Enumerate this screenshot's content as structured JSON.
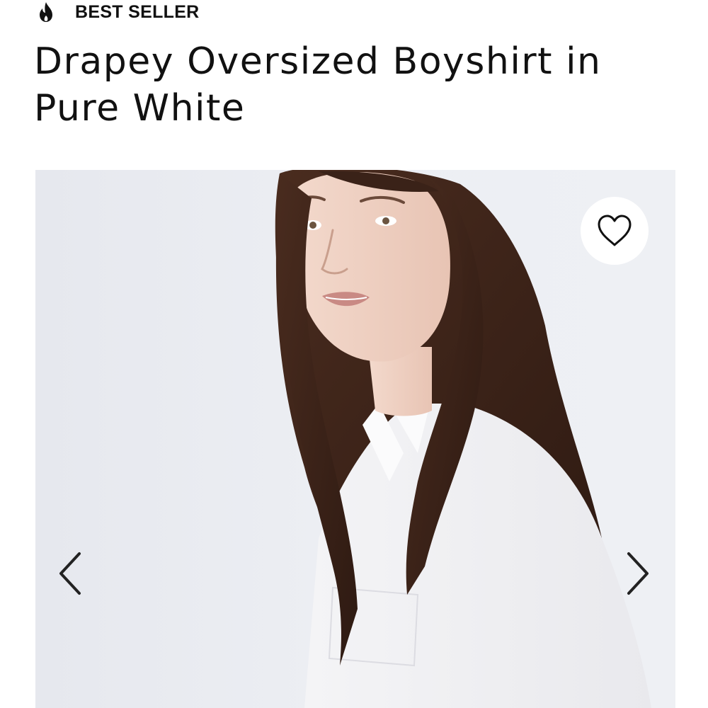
{
  "badge": {
    "icon": "flame-icon",
    "label": "BEST SELLER"
  },
  "product": {
    "title": "Drapey Oversized Boyshirt in Pure White"
  },
  "gallery": {
    "image_subject": "model wearing white oversized button-up shirt",
    "favorite_icon": "heart-outline-icon",
    "prev_icon": "chevron-left-icon",
    "next_icon": "chevron-right-icon"
  },
  "colors": {
    "text": "#111111",
    "gallery_background": "#eceef3",
    "favorite_button": "#ffffff"
  }
}
